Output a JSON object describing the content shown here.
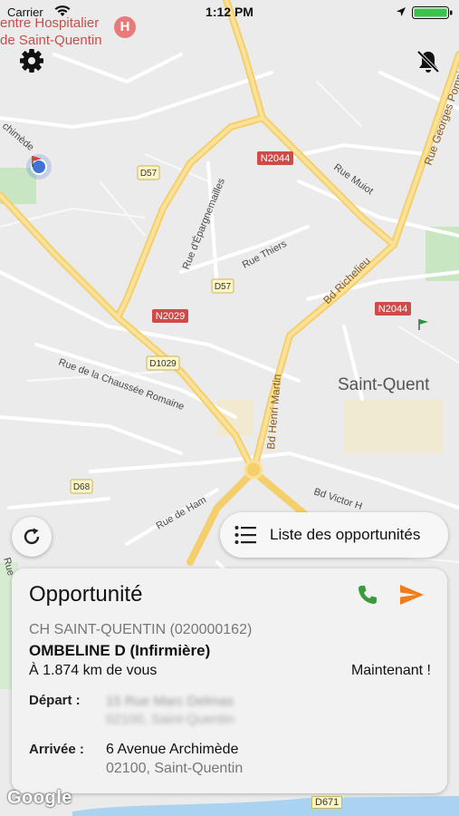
{
  "status_bar": {
    "carrier": "Carrier",
    "time": "1:12 PM"
  },
  "map": {
    "hospital_label_line1": "entre Hospitalier",
    "hospital_label_line2": "de Saint-Quentin",
    "hospital_pin": "H",
    "city_label": "Saint-Quent",
    "road_labels": {
      "n2044_top": "N2044",
      "n2044_right": "N2044",
      "n2029": "N2029",
      "d57_top": "D57",
      "d57_mid": "D57",
      "d1029": "D1029",
      "d68": "D68",
      "d671": "D671",
      "rue_muiot": "Rue Muiot",
      "rue_thiers": "Rue Thiers",
      "rue_epargnemailles": "Rue d'Épargnemailles",
      "bd_richelieu": "Bd Richelieu",
      "bd_henri_martin": "Bd Henri Martin",
      "rue_georges_pompidou": "Rue Georges Pompidou",
      "rue_chaussee_romaine": "Rue de la Chaussée Romaine",
      "rue_de_ham": "Rue de Ham",
      "bd_victor": "Bd Victor H",
      "archimede_fragment": "chimède",
      "rue_fragment": "Rue"
    },
    "attribution": "Google",
    "water_color": "#a9d3f0",
    "park_color": "#c7e6c1",
    "road_yellow": "#f8d66f"
  },
  "toolbar": {
    "settings_icon": "gear-icon",
    "notifications_icon": "bell-off-icon",
    "refresh_icon": "refresh-icon",
    "list_icon": "list-icon",
    "list_label": "Liste des opportunités"
  },
  "card": {
    "title": "Opportunité",
    "phone_icon": "phone-icon",
    "send_icon": "send-icon",
    "phone_color": "#3a9a3e",
    "send_color": "#f07d1c",
    "hospital": "CH SAINT-QUENTIN (020000162)",
    "person": "OMBELINE D (Infirmière)",
    "distance": "À 1.874 km de vous",
    "timing": "Maintenant !",
    "departure_label": "Départ :",
    "departure_line1": "15 Rue Marc Delmas",
    "departure_line2": "02100, Saint-Quentin",
    "arrival_label": "Arrivée :",
    "arrival_line1": "6 Avenue Archimède",
    "arrival_line2": "02100, Saint-Quentin"
  }
}
